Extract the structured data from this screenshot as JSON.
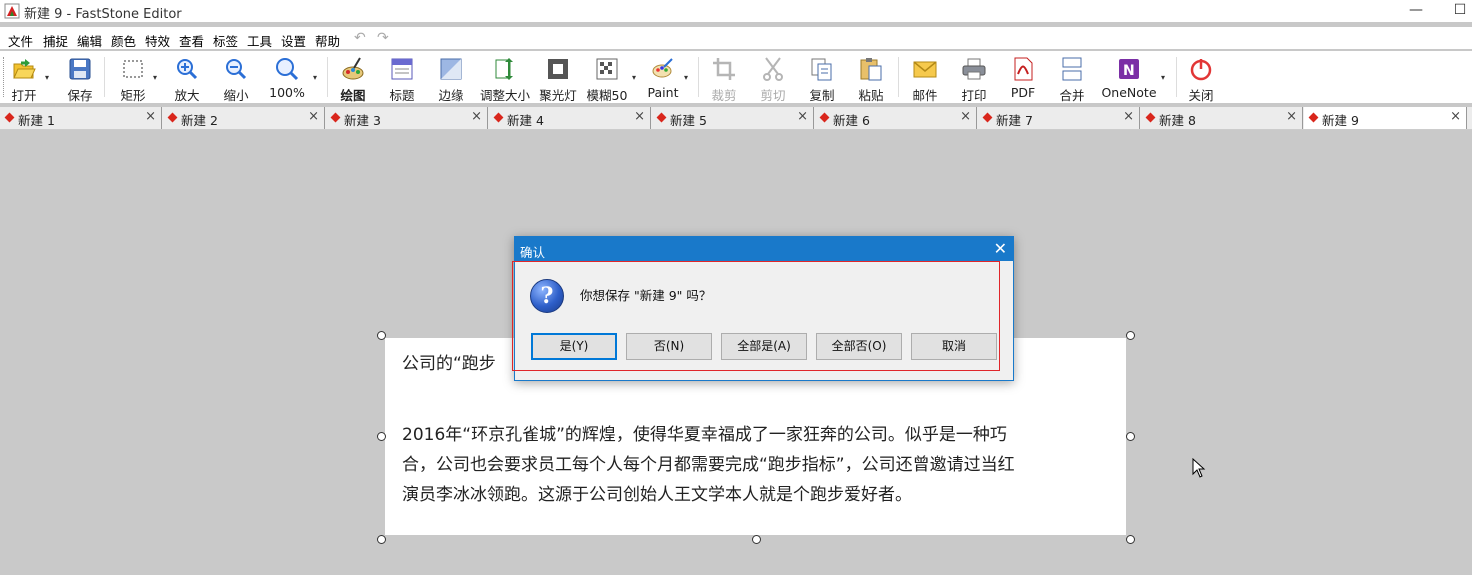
{
  "window": {
    "title": "新建 9 - FastStone Editor",
    "minimize_glyph": "—",
    "maximize_glyph": "☐"
  },
  "menu": {
    "items": [
      "文件",
      "捕捉",
      "编辑",
      "颜色",
      "特效",
      "查看",
      "标签",
      "工具",
      "设置",
      "帮助"
    ],
    "undo_glyph": "↶",
    "redo_glyph": "↷"
  },
  "toolbar": {
    "buttons": [
      {
        "label": "打开",
        "icon": "folder-open-icon"
      },
      {
        "label": "保存",
        "icon": "save-icon"
      },
      {
        "label": "矩形",
        "icon": "rectangle-select-icon"
      },
      {
        "label": "放大",
        "icon": "zoom-in-icon"
      },
      {
        "label": "缩小",
        "icon": "zoom-out-icon"
      },
      {
        "label": "100%",
        "icon": "zoom-100-icon"
      },
      {
        "label": "绘图",
        "icon": "draw-icon"
      },
      {
        "label": "标题",
        "icon": "caption-icon"
      },
      {
        "label": "边缘",
        "icon": "edge-icon"
      },
      {
        "label": "调整大小",
        "icon": "resize-icon"
      },
      {
        "label": "聚光灯",
        "icon": "spotlight-icon"
      },
      {
        "label": "模糊50",
        "icon": "blur-icon"
      },
      {
        "label": "Paint",
        "icon": "paint-icon"
      },
      {
        "label": "裁剪",
        "icon": "crop-icon",
        "disabled": true
      },
      {
        "label": "剪切",
        "icon": "cut-icon",
        "disabled": true
      },
      {
        "label": "复制",
        "icon": "copy-icon"
      },
      {
        "label": "粘贴",
        "icon": "paste-icon"
      },
      {
        "label": "邮件",
        "icon": "mail-icon"
      },
      {
        "label": "打印",
        "icon": "print-icon"
      },
      {
        "label": "PDF",
        "icon": "pdf-icon"
      },
      {
        "label": "合并",
        "icon": "merge-icon"
      },
      {
        "label": "OneNote",
        "icon": "onenote-icon"
      },
      {
        "label": "关闭",
        "icon": "power-icon"
      }
    ],
    "dropdown_glyph": "▾"
  },
  "tabs": [
    {
      "label": "新建 1"
    },
    {
      "label": "新建 2"
    },
    {
      "label": "新建 3"
    },
    {
      "label": "新建 4"
    },
    {
      "label": "新建 5"
    },
    {
      "label": "新建 6"
    },
    {
      "label": "新建 7"
    },
    {
      "label": "新建 8"
    },
    {
      "label": "新建 9",
      "active": true
    }
  ],
  "tab_close_glyph": "×",
  "document": {
    "line1": "公司的“跑步",
    "para_lines": [
      "2016年“环京孔雀城”的辉煌，使得华夏幸福成了一家狂奔的公司。似乎是一种巧",
      "合，公司也会要求员工每个人每个月都需要完成“跑步指标”，公司还曾邀请过当红",
      "演员李冰冰领跑。这源于公司创始人王文学本人就是个跑步爱好者。"
    ]
  },
  "dialog": {
    "title": "确认",
    "close_glyph": "✕",
    "icon_glyph": "?",
    "message": "你想保存 \"新建 9\" 吗？",
    "buttons": {
      "yes": "是(Y)",
      "no": "否(N)",
      "yes_all": "全部是(A)",
      "no_all": "全部否(O)",
      "cancel": "取消"
    }
  },
  "colors": {
    "dialog_title": "#1979ca",
    "highlight_frame": "#e0262a",
    "tab_marker": "#d9261c"
  }
}
